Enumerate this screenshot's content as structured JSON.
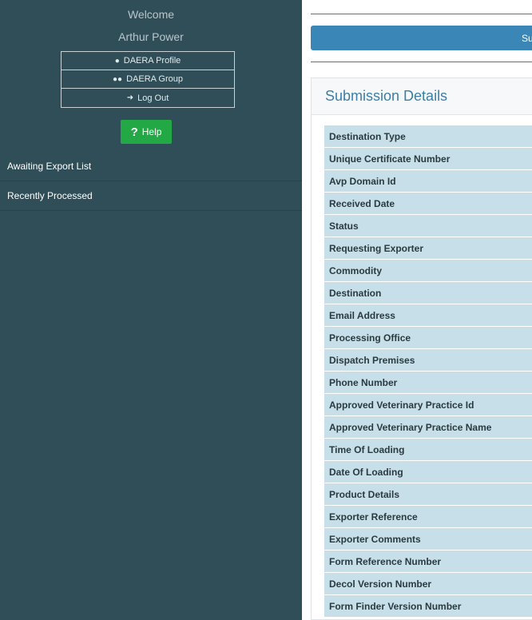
{
  "sidebar": {
    "welcome": "Welcome",
    "username": "Arthur Power",
    "menu": [
      {
        "label": "DAERA Profile",
        "icon": "user-icon"
      },
      {
        "label": "DAERA Group",
        "icon": "users-icon"
      },
      {
        "label": "Log Out",
        "icon": "sign-out-icon"
      }
    ],
    "help": {
      "label": "Help",
      "icon": "question-icon"
    },
    "nav": [
      {
        "label": "Awaiting Export List"
      },
      {
        "label": "Recently Processed"
      }
    ]
  },
  "main": {
    "banner_text": "Su",
    "panel_title": "Submission Details",
    "fields": [
      "Destination Type",
      "Unique Certificate Number",
      "Avp Domain Id",
      "Received Date",
      "Status",
      "Requesting Exporter",
      "Commodity",
      "Destination",
      "Email Address",
      "Processing Office",
      "Dispatch Premises",
      "Phone Number",
      "Approved Veterinary Practice Id",
      "Approved Veterinary Practice Name",
      "Time Of Loading",
      "Date Of Loading",
      "Product Details",
      "Exporter Reference",
      "Exporter Comments",
      "Form Reference Number",
      "Decol Version Number",
      "Form Finder Version Number"
    ]
  },
  "colors": {
    "sidebar_bg": "#2f4e58",
    "banner_blue": "#3a87b7",
    "help_green": "#22a845",
    "row_bg": "#c6dfe8"
  }
}
